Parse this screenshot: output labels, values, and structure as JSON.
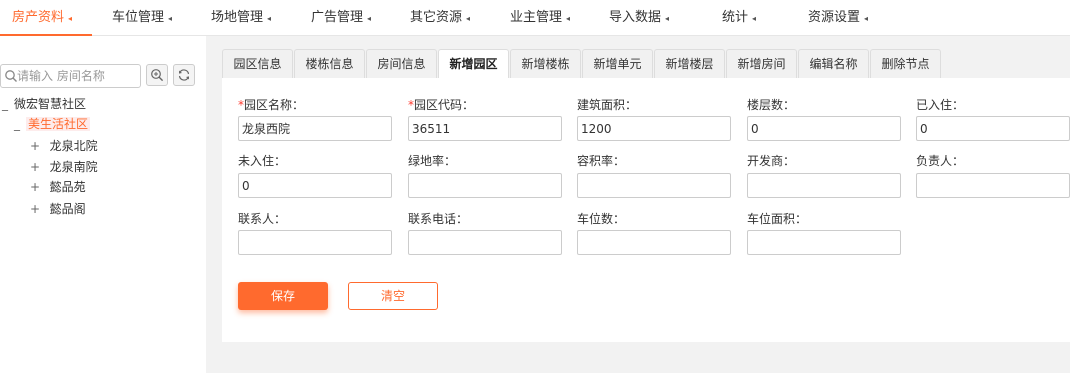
{
  "colors": {
    "accent": "#ff6a2e",
    "required": "#ff3b30",
    "main_bg": "#f2f2f2"
  },
  "topnav": {
    "items": [
      {
        "label": "房产资料"
      },
      {
        "label": "车位管理"
      },
      {
        "label": "场地管理"
      },
      {
        "label": "广告管理"
      },
      {
        "label": "其它资源"
      },
      {
        "label": "业主管理"
      },
      {
        "label": "导入数据"
      },
      {
        "label": "统计"
      },
      {
        "label": "资源设置"
      }
    ],
    "caret": "◂"
  },
  "sidebar": {
    "search": {
      "placeholder": "请输入 房间名称",
      "icon": "search-icon"
    },
    "tools": [
      {
        "icon": "zoom-search-icon"
      },
      {
        "icon": "refresh-icon"
      }
    ],
    "tree": [
      {
        "toggle": "_",
        "label": "微宏智慧社区"
      },
      {
        "toggle": "_",
        "label": "美生活社区"
      },
      {
        "toggle": "+",
        "label": "龙泉北院"
      },
      {
        "toggle": "+",
        "label": "龙泉南院"
      },
      {
        "toggle": "+",
        "label": "懿品苑"
      },
      {
        "toggle": "+",
        "label": "懿品阁"
      }
    ]
  },
  "tabs": [
    {
      "label": "园区信息"
    },
    {
      "label": "楼栋信息"
    },
    {
      "label": "房间信息"
    },
    {
      "label": "新增园区"
    },
    {
      "label": "新增楼栋"
    },
    {
      "label": "新增单元"
    },
    {
      "label": "新增楼层"
    },
    {
      "label": "新增房间"
    },
    {
      "label": "编辑名称"
    },
    {
      "label": "删除节点"
    }
  ],
  "form": {
    "required_mark": "*",
    "fields": [
      {
        "label": "园区名称：",
        "value": "龙泉西院"
      },
      {
        "label": "园区代码：",
        "value": "36511"
      },
      {
        "label": "建筑面积：",
        "value": "1200"
      },
      {
        "label": "楼层数：",
        "value": "0"
      },
      {
        "label": "已入住：",
        "value": "0"
      },
      {
        "label": "未入住：",
        "value": "0"
      },
      {
        "label": "绿地率：",
        "value": ""
      },
      {
        "label": "容积率：",
        "value": ""
      },
      {
        "label": "开发商：",
        "value": ""
      },
      {
        "label": "负责人：",
        "value": ""
      },
      {
        "label": "联系人：",
        "value": ""
      },
      {
        "label": "联系电话：",
        "value": ""
      },
      {
        "label": "车位数：",
        "value": ""
      },
      {
        "label": "车位面积：",
        "value": ""
      }
    ]
  },
  "buttons": {
    "save": "保存",
    "clear": "清空"
  }
}
